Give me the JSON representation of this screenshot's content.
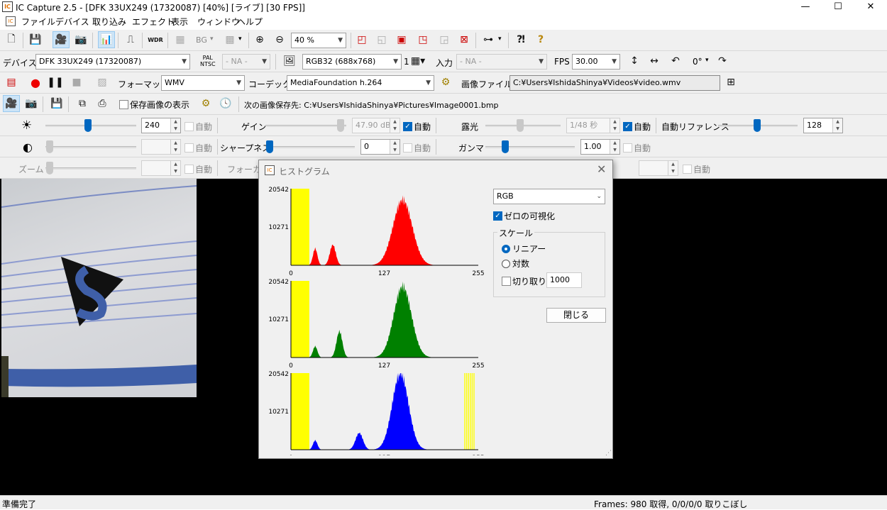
{
  "window": {
    "title": "IC Capture 2.5 - [DFK 33UX249 (17320087) [40%] [ライブ] [30 FPS]]",
    "app_icon_text": "IC",
    "minimize": "—",
    "maximize": "☐",
    "close": "✕"
  },
  "menu": [
    "ファイル",
    "デバイス",
    "取り込み",
    "エフェクト",
    "表示",
    "ウィンドウ",
    "ヘルプ"
  ],
  "toolbar1": {
    "zoom": "40 %",
    "bg_label": "BG",
    "wdr_label": "WDR"
  },
  "toolbar2": {
    "device_label": "デバイス",
    "device_value": "DFK 33UX249 (17320087)",
    "pal_label": "PAL\nNTSC",
    "video_norm": "- NA -",
    "format_value": "RGB32 (688x768)",
    "binning_label": "1",
    "input_label": "入力",
    "input_value": "- NA -",
    "fps_label": "FPS",
    "fps_value": "30.00",
    "rotation_value": "0°"
  },
  "toolbar3": {
    "format_label": "フォーマット",
    "format_value": "WMV",
    "codec_label": "コーデック",
    "codec_value": "MediaFoundation h.264",
    "file_label": "画像ファイル",
    "file_value": "C:¥Users¥IshidaShinya¥Videos¥video.wmv"
  },
  "toolbar4": {
    "show_saved_label": "保存画像の表示",
    "next_save_label": "次の画像保存先: C:¥Users¥IshidaShinya¥Pictures¥Image0001.bmp"
  },
  "props": {
    "auto": "自動",
    "brightness_value": "240",
    "gain_label": "ゲイン",
    "gain_value": "47.90 dB",
    "exposure_label": "露光",
    "exposure_value": "1/48 秒",
    "wb_label": "自動リファレンス",
    "wb_value": "128",
    "contrast_value": "",
    "sharpness_label": "シャープネス",
    "sharpness_value": "0",
    "gamma_label": "ガンマ",
    "gamma_value": "1.00",
    "zoom_label": "ズーム",
    "zoom_value": "",
    "focus_label": "フォーカス",
    "focus_value": ""
  },
  "histogram": {
    "title": "ヒストグラム",
    "channel": "RGB",
    "show_zero_label": "ゼロの可視化",
    "scale_group": "スケール",
    "linear_label": "リニアー",
    "log_label": "対数",
    "clip_label": "切り取り",
    "clip_value": "1000",
    "close_label": "閉じる",
    "ymax_label": "20542",
    "ymid_label": "10271",
    "x_ticks": [
      "0",
      "127",
      "255"
    ],
    "colors": {
      "red": "#ff0000",
      "green": "#008000",
      "blue": "#0000ff",
      "zero": "#ffff00"
    }
  },
  "chart_data": [
    {
      "type": "area",
      "title": "Red",
      "x_range": [
        0,
        255
      ],
      "ylim": [
        0,
        20542
      ],
      "zero_band": [
        [
          0,
          25
        ]
      ],
      "peaks": [
        {
          "x": 33,
          "h": 4500,
          "w": 3
        },
        {
          "x": 57,
          "h": 5500,
          "w": 4
        },
        {
          "x": 152,
          "h": 17500,
          "w": 13
        }
      ]
    },
    {
      "type": "area",
      "title": "Green",
      "x_range": [
        0,
        255
      ],
      "ylim": [
        0,
        20542
      ],
      "zero_band": [
        [
          0,
          25
        ]
      ],
      "peaks": [
        {
          "x": 33,
          "h": 3000,
          "w": 3
        },
        {
          "x": 66,
          "h": 7000,
          "w": 4
        },
        {
          "x": 152,
          "h": 19000,
          "w": 12
        }
      ]
    },
    {
      "type": "area",
      "title": "Blue",
      "x_range": [
        0,
        255
      ],
      "ylim": [
        0,
        20542
      ],
      "zero_band": [
        [
          0,
          25
        ],
        [
          236,
          250
        ]
      ],
      "peaks": [
        {
          "x": 33,
          "h": 2500,
          "w": 3
        },
        {
          "x": 93,
          "h": 4500,
          "w": 5
        },
        {
          "x": 149,
          "h": 20500,
          "w": 11
        }
      ]
    }
  ],
  "statusbar": {
    "left": "準備完了",
    "right": "Frames: 980 取得, 0/0/0/0 取りこぼし"
  }
}
